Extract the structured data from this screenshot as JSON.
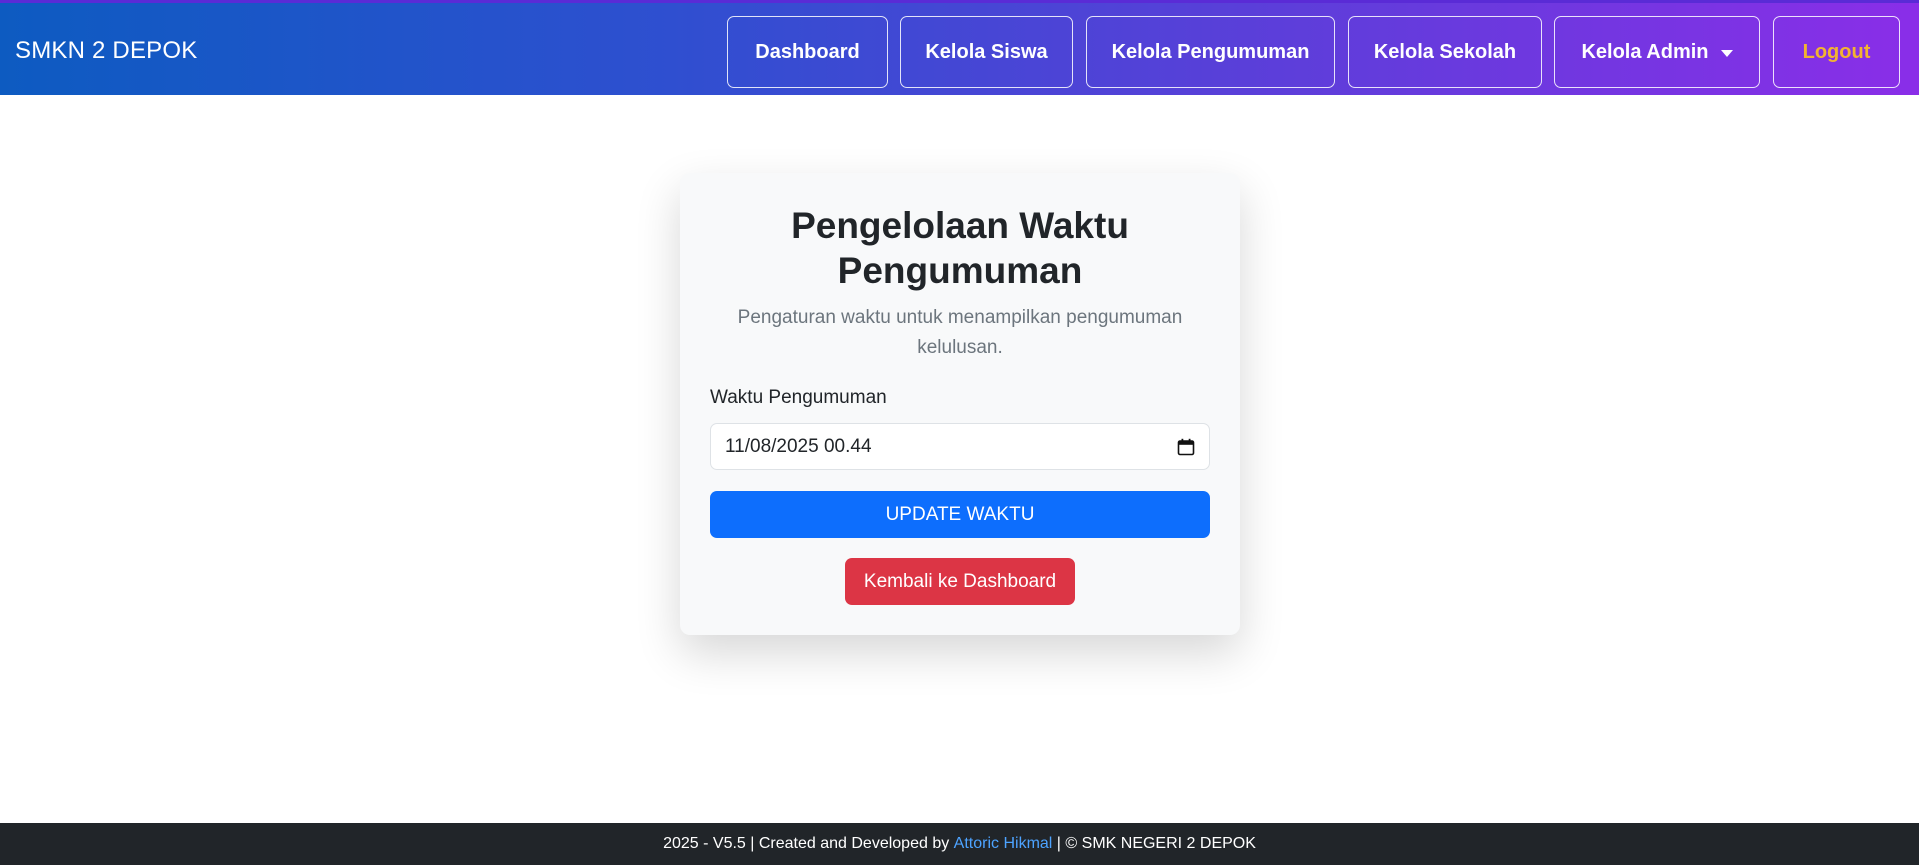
{
  "navbar": {
    "brand": "SMKN 2 DEPOK",
    "items": [
      {
        "label": "Dashboard"
      },
      {
        "label": "Kelola Siswa"
      },
      {
        "label": "Kelola Pengumuman"
      },
      {
        "label": "Kelola Sekolah"
      },
      {
        "label": "Kelola Admin"
      },
      {
        "label": "Logout"
      }
    ]
  },
  "card": {
    "title": "Pengelolaan Waktu Pengumuman",
    "subtitle": "Pengaturan waktu untuk menampilkan pengumuman kelulusan.",
    "field_label": "Waktu Pengumuman",
    "field_value": "11/08/2025 00.44",
    "update_label": "UPDATE WAKTU",
    "back_label": "Kembali ke Dashboard"
  },
  "footer": {
    "prefix": "2025 - V5.5 | Created and Developed by ",
    "author": "Attoric Hikmal",
    "suffix": " | © SMK NEGERI 2 DEPOK"
  },
  "colors": {
    "primary": "#0d6efd",
    "danger": "#dc3545",
    "logout": "#f2b331",
    "footer_bg": "#212529",
    "link": "#4da3ff"
  },
  "icons": {
    "dropdown": "chevron-down-icon",
    "calendar": "calendar-icon"
  }
}
